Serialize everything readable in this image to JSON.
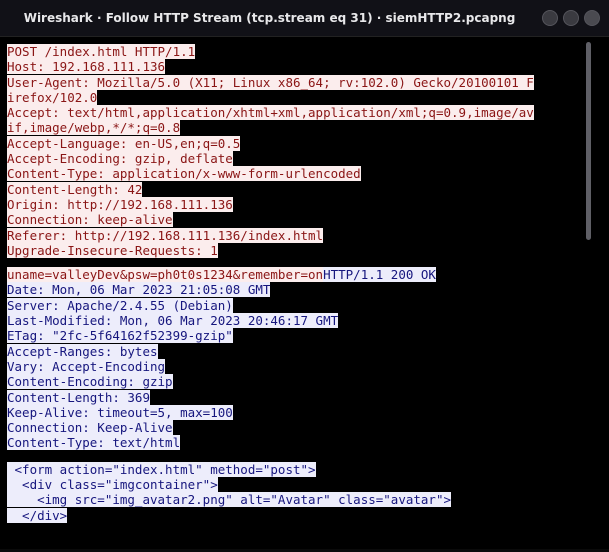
{
  "window": {
    "title": "Wireshark · Follow HTTP Stream (tcp.stream eq 31) · siemHTTP2.pcapng"
  },
  "stream": {
    "request_lines": [
      "POST /index.html HTTP/1.1",
      "Host: 192.168.111.136",
      "User-Agent: Mozilla/5.0 (X11; Linux x86_64; rv:102.0) Gecko/20100101 F",
      "irefox/102.0",
      "Accept: text/html,application/xhtml+xml,application/xml;q=0.9,image/av",
      "if,image/webp,*/*;q=0.8",
      "Accept-Language: en-US,en;q=0.5",
      "Accept-Encoding: gzip, deflate",
      "Content-Type: application/x-www-form-urlencoded",
      "Content-Length: 42",
      "Origin: http://192.168.111.136",
      "Connection: keep-alive",
      "Referer: http://192.168.111.136/index.html",
      "Upgrade-Insecure-Requests: 1"
    ],
    "request_body": "uname=valleyDev&psw=ph0t0s1234&remember=on",
    "response_lines": [
      "HTTP/1.1 200 OK",
      "Date: Mon, 06 Mar 2023 21:05:08 GMT",
      "Server: Apache/2.4.55 (Debian)",
      "Last-Modified: Mon, 06 Mar 2023 20:46:17 GMT",
      "ETag: \"2fc-5f64162f52399-gzip\"",
      "Accept-Ranges: bytes",
      "Vary: Accept-Encoding",
      "Content-Encoding: gzip",
      "Content-Length: 369",
      "Keep-Alive: timeout=5, max=100",
      "Connection: Keep-Alive",
      "Content-Type: text/html"
    ],
    "response_body_lines": [
      " <form action=\"index.html\" method=\"post\">",
      "  <div class=\"imgcontainer\">",
      "    <img src=\"img_avatar2.png\" alt=\"Avatar\" class=\"avatar\">",
      "  </div>"
    ]
  },
  "colors": {
    "client_bg": "#fbeded",
    "client_fg": "#8a1515",
    "server_bg": "#ededfb",
    "server_fg": "#16167e"
  }
}
